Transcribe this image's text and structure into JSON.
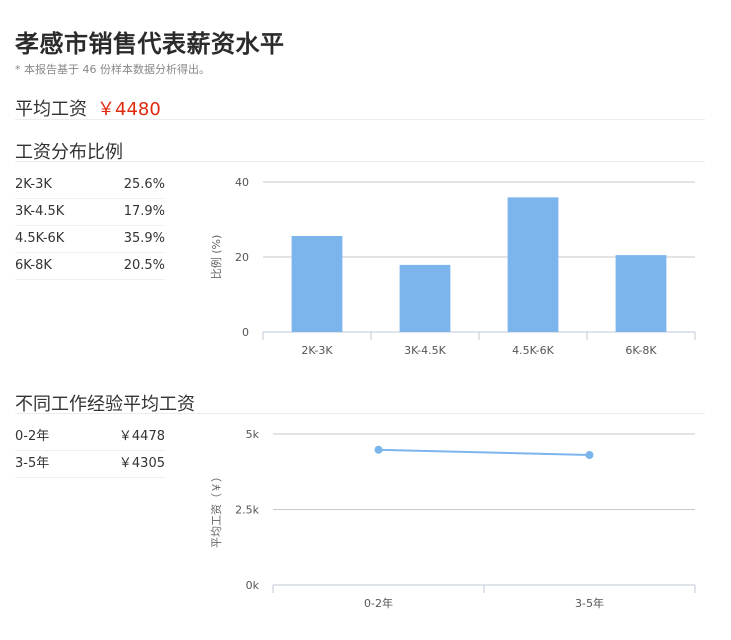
{
  "page": {
    "title": "孝感市销售代表薪资水平",
    "note": "* 本报告基于 46 份样本数据分析得出。",
    "avg_label": "平均工资",
    "avg_value": "￥4480"
  },
  "dist": {
    "heading": "工资分布比例",
    "rows": [
      {
        "range": "2K-3K",
        "pct": "25.6%"
      },
      {
        "range": "3K-4.5K",
        "pct": "17.9%"
      },
      {
        "range": "4.5K-6K",
        "pct": "35.9%"
      },
      {
        "range": "6K-8K",
        "pct": "20.5%"
      }
    ]
  },
  "exp": {
    "heading": "不同工作经验平均工资",
    "rows": [
      {
        "years": "0-2年",
        "salary": "￥4478"
      },
      {
        "years": "3-5年",
        "salary": "￥4305"
      }
    ]
  },
  "chart_data": [
    {
      "type": "bar",
      "categories": [
        "2K-3K",
        "3K-4.5K",
        "4.5K-6K",
        "6K-8K"
      ],
      "values": [
        25.6,
        17.9,
        35.9,
        20.5
      ],
      "ylabel": "比例 (%)",
      "ylim": [
        0,
        40
      ],
      "yticks": [
        "0",
        "20",
        "40"
      ],
      "ytick_values": [
        0,
        20,
        40
      ],
      "grid": true,
      "color": "#7cb5ec"
    },
    {
      "type": "line",
      "categories": [
        "0-2年",
        "3-5年"
      ],
      "values": [
        4478,
        4305
      ],
      "ylabel": "平均工资（￥）",
      "ylim": [
        0,
        5000
      ],
      "yticks": [
        "0k",
        "2.5k",
        "5k"
      ],
      "ytick_values": [
        0,
        2500,
        5000
      ],
      "grid": true,
      "color": "#7cb5ec"
    }
  ]
}
